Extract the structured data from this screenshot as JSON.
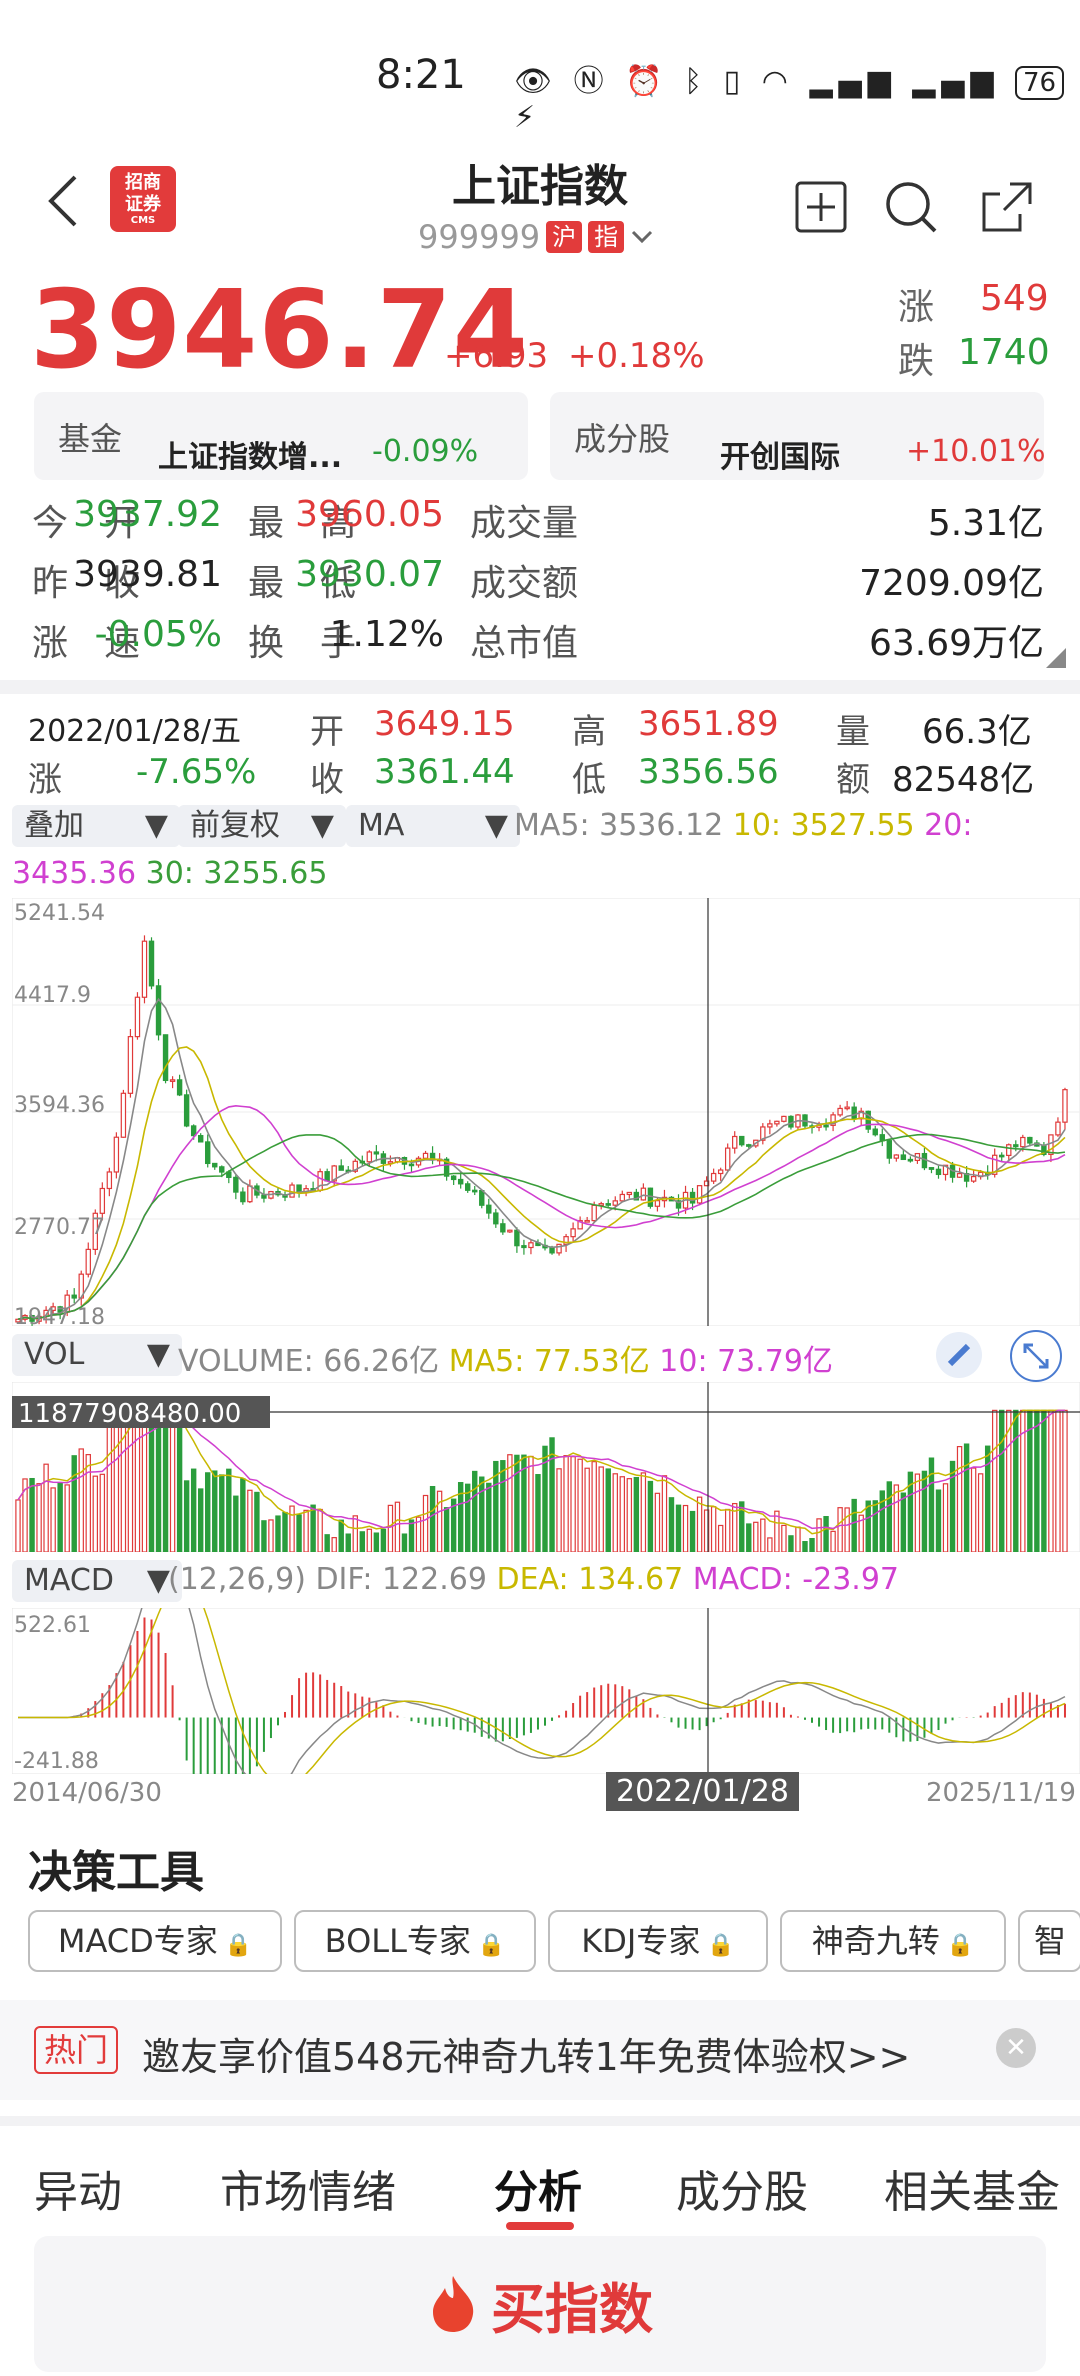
{
  "status_bar": {
    "time": "8:21",
    "battery": "76"
  },
  "header": {
    "logo_line1": "招商",
    "logo_line2": "证券",
    "logo_sub": "CMS",
    "title": "上证指数",
    "code": "999999",
    "tag1": "沪",
    "tag2": "指"
  },
  "quote": {
    "price": "3946.74",
    "change": "+6.93",
    "change_pct": "+0.18%",
    "up_label": "涨",
    "up_count": "549",
    "down_label": "跌",
    "down_count": "1740"
  },
  "cards": [
    {
      "label": "基金",
      "name": "上证指数增...",
      "value": "-0.09%"
    },
    {
      "label": "成分股",
      "name": "开创国际",
      "value": "+10.01%"
    }
  ],
  "stats": [
    {
      "l1": "今",
      "l2": "开",
      "v": "3937.92",
      "c": "green",
      "l3": "最",
      "l4": "高",
      "v2": "3960.05",
      "c2": "red",
      "l5": "成交量",
      "v3": "5.31亿"
    },
    {
      "l1": "昨",
      "l2": "收",
      "v": "3939.81",
      "c": "black",
      "l3": "最",
      "l4": "低",
      "v2": "3930.07",
      "c2": "green",
      "l5": "成交额",
      "v3": "7209.09亿"
    },
    {
      "l1": "涨",
      "l2": "速",
      "v": "-0.05%",
      "c": "green",
      "l3": "换",
      "l4": "手",
      "v2": "1.12%",
      "c2": "black",
      "l5": "总市值",
      "v3": "63.69万亿"
    }
  ],
  "candle_info": {
    "date": "2022/01/28/五",
    "open_label": "开",
    "open": "3649.15",
    "high_label": "高",
    "high": "3651.89",
    "vol_label": "量",
    "vol": "66.3亿",
    "chg_label": "涨",
    "chg": "-7.65%",
    "close_label": "收",
    "close": "3361.44",
    "low_label": "低",
    "low": "3356.56",
    "amt_label": "额",
    "amt": "82548亿"
  },
  "chart_toolbar": {
    "overlay": "叠加",
    "adjust": "前复权",
    "indicator": "MA",
    "ma5": "MA5: 3536.12",
    "ma10": "10: 3527.55",
    "ma20": "20:",
    "ma20_val": "3435.36",
    "ma30": "30: 3255.65"
  },
  "kline_axis": [
    "5241.54",
    "4417.9",
    "3594.36",
    "2770.77",
    "1947.18"
  ],
  "vol_toolbar": {
    "name": "VOL",
    "volume": "VOLUME: 66.26亿",
    "ma5": "MA5: 77.53亿",
    "ma10": "10: 73.79亿",
    "cursor_value": "11877908480.00"
  },
  "macd_toolbar": {
    "name": "MACD",
    "params": "(12,26,9) DIF: 122.69",
    "dea": "DEA: 134.67",
    "macd": "MACD: -23.97",
    "top": "522.61",
    "bottom": "-241.88"
  },
  "x_axis": {
    "start": "2014/06/30",
    "cursor": "2022/01/28",
    "end": "2025/11/19"
  },
  "tools": {
    "title": "决策工具",
    "items": [
      "MACD专家",
      "BOLL专家",
      "KDJ专家",
      "神奇九转",
      "智"
    ]
  },
  "promo": {
    "tag": "热门",
    "text": "邀友享价值548元神奇九转1年免费体验权>>"
  },
  "bottom_tabs": [
    "异动",
    "市场情绪",
    "分析",
    "成分股",
    "相关基金"
  ],
  "buy_button": "买指数",
  "colors": {
    "red": "#e03a3a",
    "green": "#2a9d3c",
    "ma5": "#888888",
    "ma10": "#c8b800",
    "ma20": "#d040d0",
    "ma30": "#3a9d3a"
  }
}
